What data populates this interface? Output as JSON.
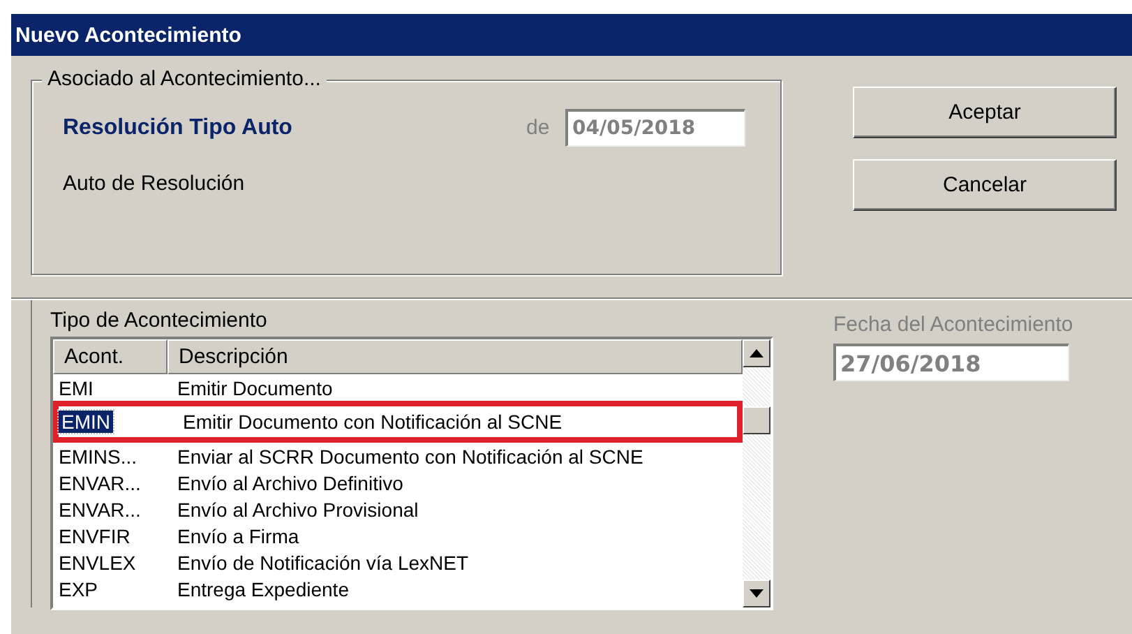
{
  "window": {
    "title": "Nuevo Acontecimiento"
  },
  "associated": {
    "legend": "Asociado al Acontecimiento...",
    "type": "Resolución Tipo Auto",
    "date_label": "de",
    "date": "04/05/2018",
    "description": "Auto de Resolución"
  },
  "buttons": [
    {
      "label": "Aceptar"
    },
    {
      "label": "Cancelar"
    }
  ],
  "event_type": {
    "legend": "Tipo de Acontecimiento",
    "columns": [
      "Acont.",
      "Descripción"
    ],
    "rows": [
      {
        "code": "EMI",
        "description": "Emitir Documento",
        "selected": false,
        "annotated": false
      },
      {
        "code": "EMIN",
        "description": "Emitir Documento con Notificación al SCNE",
        "selected": true,
        "annotated": true
      },
      {
        "code": "EMINS...",
        "description": "Enviar al SCRR Documento con Notificación al SCNE",
        "selected": false,
        "annotated": false
      },
      {
        "code": "ENVAR...",
        "description": "Envío al Archivo Definitivo",
        "selected": false,
        "annotated": false
      },
      {
        "code": "ENVAR...",
        "description": "Envío al Archivo Provisional",
        "selected": false,
        "annotated": false
      },
      {
        "code": "ENVFIR",
        "description": "Envío a Firma",
        "selected": false,
        "annotated": false
      },
      {
        "code": "ENVLEX",
        "description": "Envío de Notificación vía LexNET",
        "selected": false,
        "annotated": false
      },
      {
        "code": "EXP",
        "description": "Entrega Expediente",
        "selected": false,
        "annotated": false
      }
    ]
  },
  "event_date": {
    "label": "Fecha del Acontecimiento",
    "value": "27/06/2018"
  }
}
